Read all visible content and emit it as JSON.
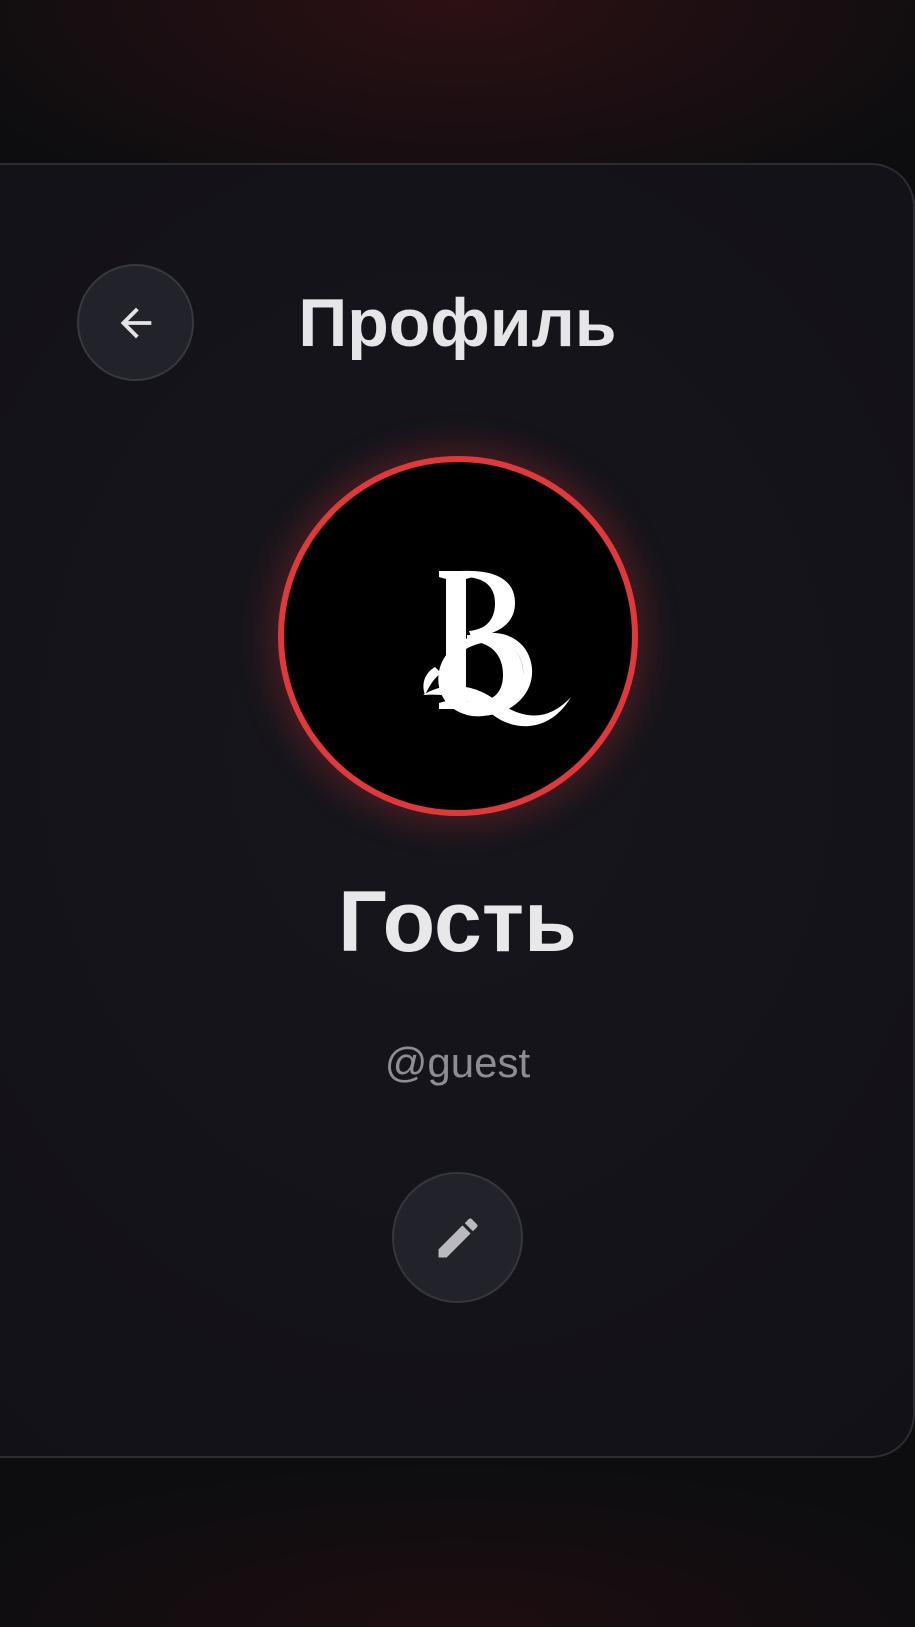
{
  "header": {
    "title": "Профиль",
    "back_icon": "arrow-left-icon"
  },
  "profile": {
    "avatar_logo": "BQ",
    "display_name": "Гость",
    "username": "@guest",
    "edit_icon": "pencil-icon"
  },
  "colors": {
    "background": "#0d0d10",
    "card": "#141319",
    "accent_ring": "#e0393b",
    "text_primary": "#e6e6e9",
    "text_secondary": "#8d8d94"
  }
}
